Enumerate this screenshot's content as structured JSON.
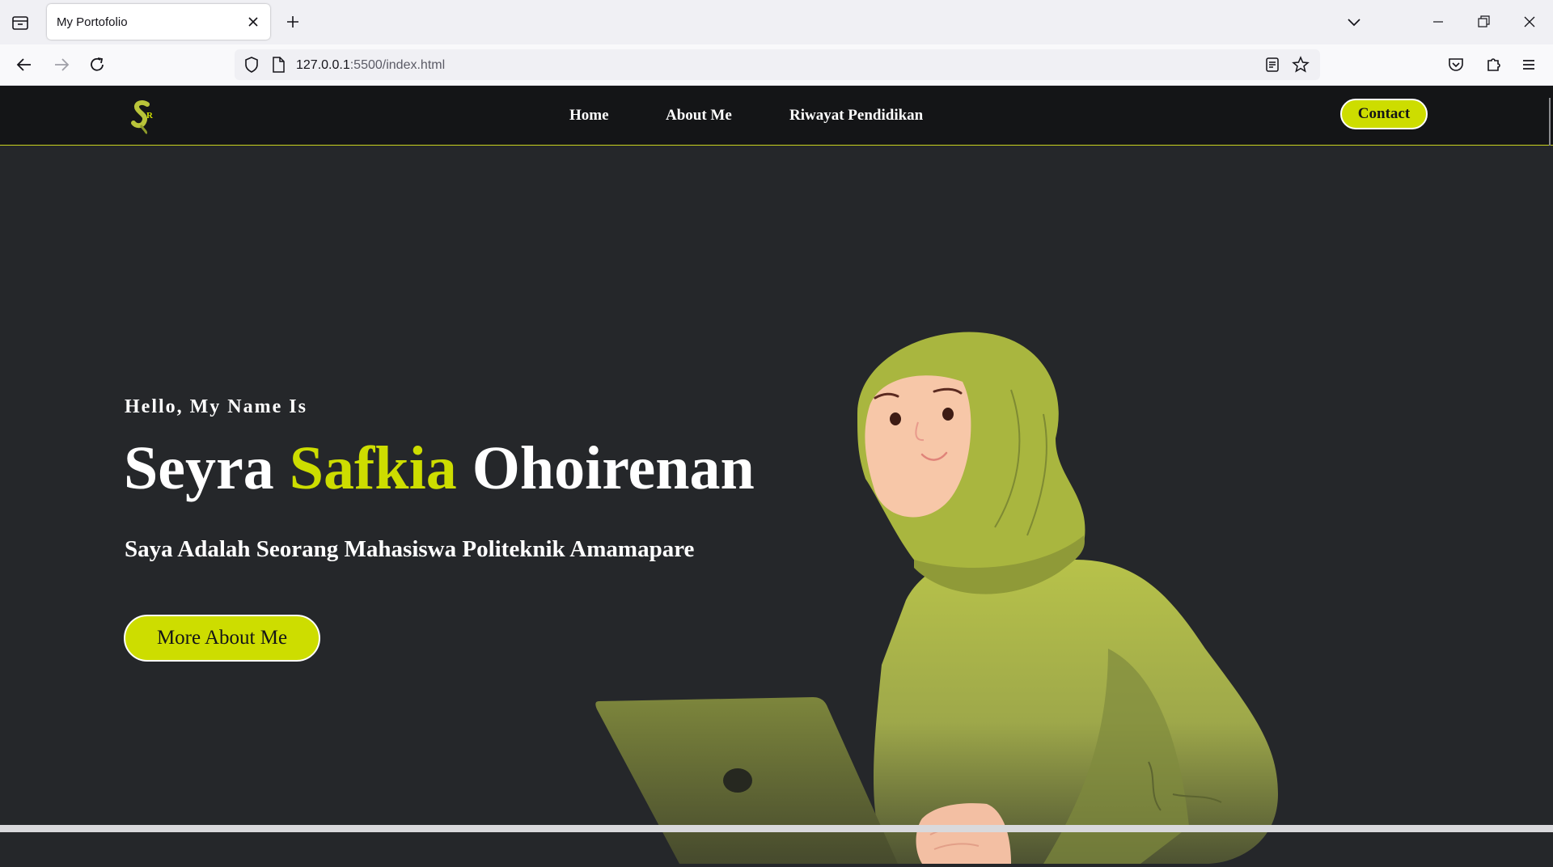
{
  "browser": {
    "tab_title": "My Portofolio",
    "url_host": "127.0.0.1",
    "url_rest": ":5500/index.html"
  },
  "site": {
    "nav": {
      "home": "Home",
      "about": "About Me",
      "education": "Riwayat Pendidikan",
      "contact": "Contact"
    },
    "hero": {
      "greeting": "Hello, My Name Is",
      "name_first": "Seyra ",
      "name_middle": "Safkia",
      "name_last": " Ohoirenan",
      "subtitle": "Saya Adalah Seorang Mahasiswa Politeknik Amamapare",
      "button": "More About Me"
    },
    "colors": {
      "accent": "#cddd00",
      "header_bg": "#141517",
      "page_bg": "#25272a"
    }
  },
  "icons": [
    "tab-list-icon",
    "close-icon",
    "plus-icon",
    "chevron-down-icon",
    "minimize-icon",
    "restore-icon",
    "window-close-icon",
    "back-arrow-icon",
    "forward-arrow-icon",
    "reload-icon",
    "shield-icon",
    "page-icon",
    "reader-view-icon",
    "star-icon",
    "pocket-icon",
    "extensions-icon",
    "menu-icon"
  ]
}
